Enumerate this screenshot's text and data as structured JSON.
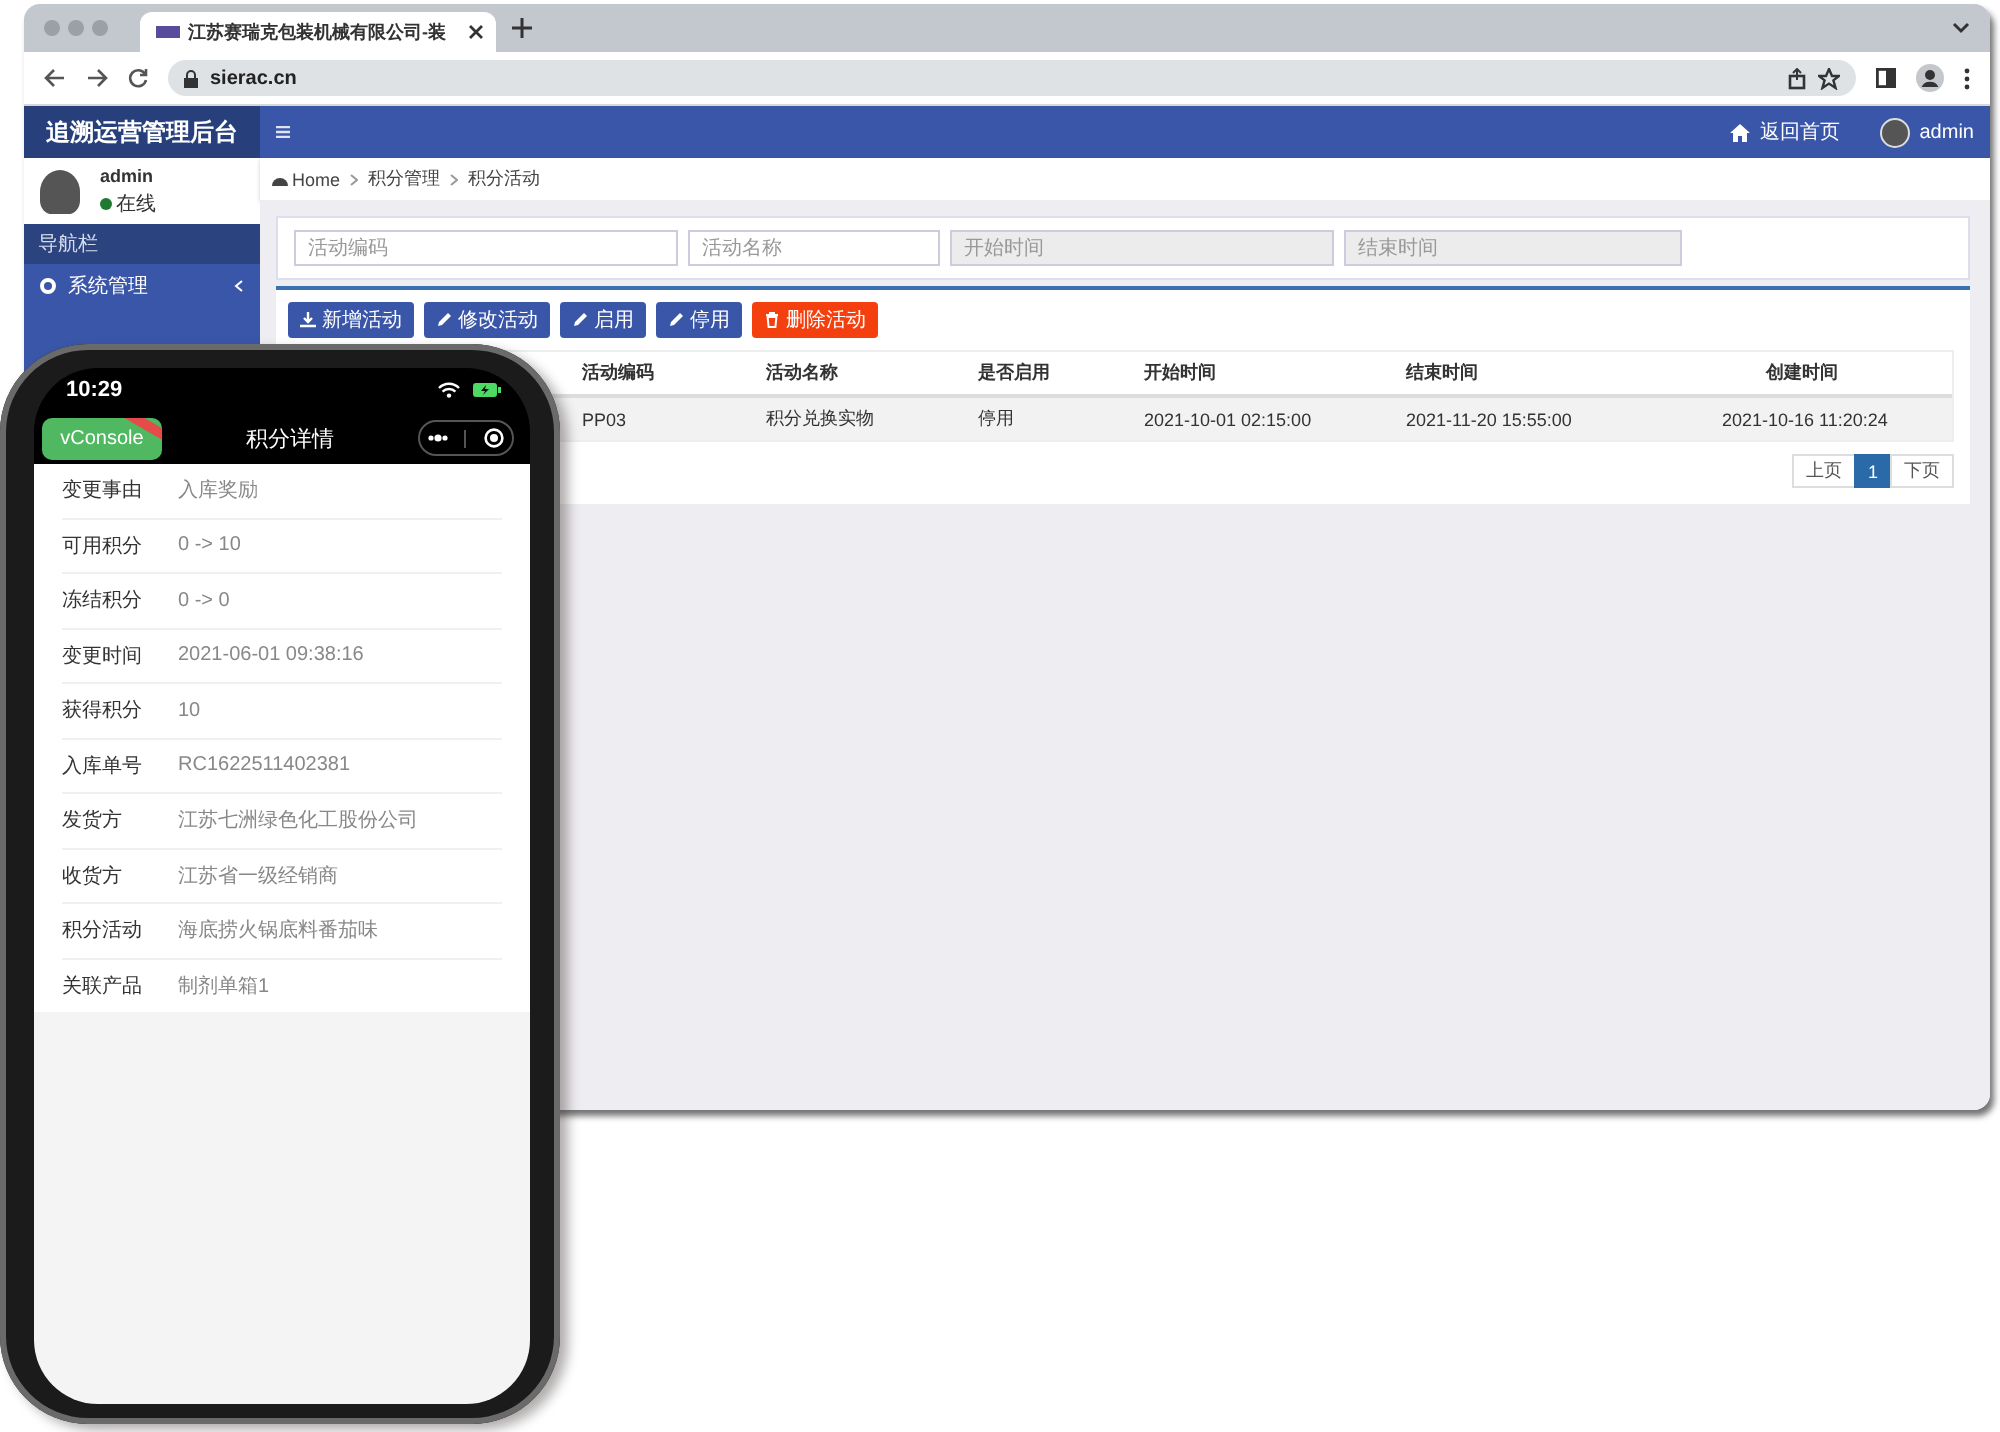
{
  "browser": {
    "tab_title": "江苏赛瑞克包装机械有限公司-装",
    "url": "sierac.cn"
  },
  "app": {
    "brand": "追溯运营管理后台",
    "header_links": [
      {
        "kind": "home",
        "label": "返回首页"
      },
      {
        "kind": "user",
        "label": "admin"
      }
    ],
    "user": {
      "name": "admin",
      "status": "在线",
      "online": true
    },
    "nav_heading": "导航栏",
    "sidebar_items": [
      {
        "label": "系统管理",
        "expanded": false
      }
    ],
    "breadcrumb": [
      "Home",
      "积分管理",
      "积分活动"
    ],
    "filters": [
      {
        "placeholder": "活动编码",
        "disabled": false
      },
      {
        "placeholder": "活动名称",
        "disabled": false
      },
      {
        "placeholder": "开始时间",
        "disabled": true
      },
      {
        "placeholder": "结束时间",
        "disabled": true
      }
    ],
    "buttons": [
      {
        "kind": "add",
        "label": "新增活动"
      },
      {
        "kind": "edit",
        "label": "修改活动"
      },
      {
        "kind": "enable",
        "label": "启用"
      },
      {
        "kind": "disable",
        "label": "停用"
      },
      {
        "kind": "delete",
        "label": "删除活动"
      }
    ],
    "table": {
      "columns": [
        "活动编码",
        "活动名称",
        "是否启用",
        "开始时间",
        "结束时间",
        "创建时间"
      ],
      "rows": [
        [
          "PP03",
          "积分兑换实物",
          "停用",
          "2021-10-01 02:15:00",
          "2021-11-20 15:55:00",
          "2021-10-16 11:20:24"
        ]
      ]
    },
    "pagination": {
      "prev": "上页",
      "pages": [
        {
          "label": "1",
          "selected": true
        }
      ],
      "next": "下页"
    }
  },
  "phone": {
    "time": "10:29",
    "vconsole": "vConsole",
    "title": "积分详情",
    "fields": [
      {
        "label": "变更事由",
        "value": "入库奖励"
      },
      {
        "label": "可用积分",
        "value": "0 -> 10"
      },
      {
        "label": "冻结积分",
        "value": "0 -> 0"
      },
      {
        "label": "变更时间",
        "value": "2021-06-01 09:38:16"
      },
      {
        "label": "获得积分",
        "value": "10"
      },
      {
        "label": "入库单号",
        "value": "RC1622511402381"
      },
      {
        "label": "发货方",
        "value": "江苏七洲绿色化工股份公司"
      },
      {
        "label": "收货方",
        "value": "江苏省一级经销商"
      },
      {
        "label": "积分活动",
        "value": "海底捞火锅底料番茄味"
      },
      {
        "label": "关联产品",
        "value": "制剂单箱1"
      }
    ]
  }
}
